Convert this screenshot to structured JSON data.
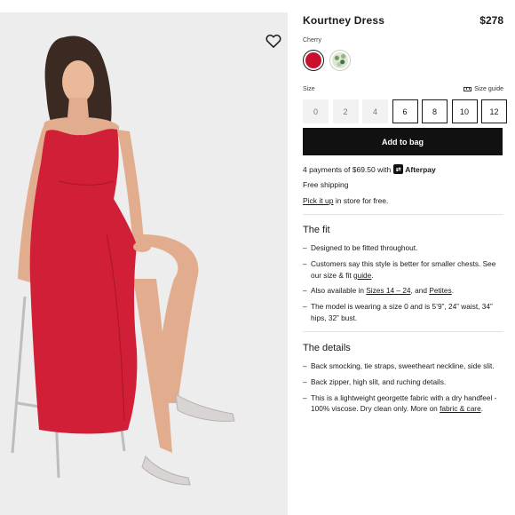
{
  "product": {
    "title": "Kourtney Dress",
    "price": "$278",
    "color_label": "Cherry",
    "colors": [
      {
        "name": "Cherry",
        "hex": "#c8102e",
        "selected": true
      },
      {
        "name": "floral",
        "hex": "#dfe6d4",
        "selected": false
      }
    ]
  },
  "size": {
    "label": "Size",
    "guide_label": "Size guide",
    "options": [
      {
        "label": "0",
        "available": false
      },
      {
        "label": "2",
        "available": false
      },
      {
        "label": "4",
        "available": false
      },
      {
        "label": "6",
        "available": true
      },
      {
        "label": "8",
        "available": true
      },
      {
        "label": "10",
        "available": true
      },
      {
        "label": "12",
        "available": true
      }
    ]
  },
  "cta": {
    "add_to_bag": "Add to bag"
  },
  "payment": {
    "prefix": "4 payments of $69.50 with",
    "provider": "Afterpay"
  },
  "shipping": {
    "free_shipping": "Free shipping",
    "pickup_link": "Pick it up",
    "pickup_rest": "in store for free."
  },
  "fit": {
    "heading": "The fit",
    "b1": "Designed to be fitted throughout.",
    "b2_pre": "Customers say this style is better for smaller chests. See our size & fit ",
    "b2_link": "guide",
    "b2_post": ".",
    "b3_pre": "Also available in ",
    "b3_link1": "Sizes 14 – 24",
    "b3_mid": ", and ",
    "b3_link2": "Petites",
    "b3_post": ".",
    "b4": "The model is wearing a size 0 and is 5’9”, 24” waist, 34” hips, 32” bust."
  },
  "details": {
    "heading": "The details",
    "b1": "Back smocking, tie straps, sweetheart neckline, side slit.",
    "b2": "Back zipper, high slit, and ruching details.",
    "b3_pre": "This is a lightweight georgette fabric with a dry handfeel - 100% viscose. Dry clean only. More on ",
    "b3_link": "fabric & care",
    "b3_post": "."
  },
  "icons": {
    "favorite": "heart-outline-icon",
    "size_guide": "ruler-icon",
    "afterpay": "afterpay-logo-icon"
  },
  "colors_ui": {
    "accent_dress": "#d01f36",
    "button_bg": "#111111",
    "photo_bg": "#ededed"
  }
}
